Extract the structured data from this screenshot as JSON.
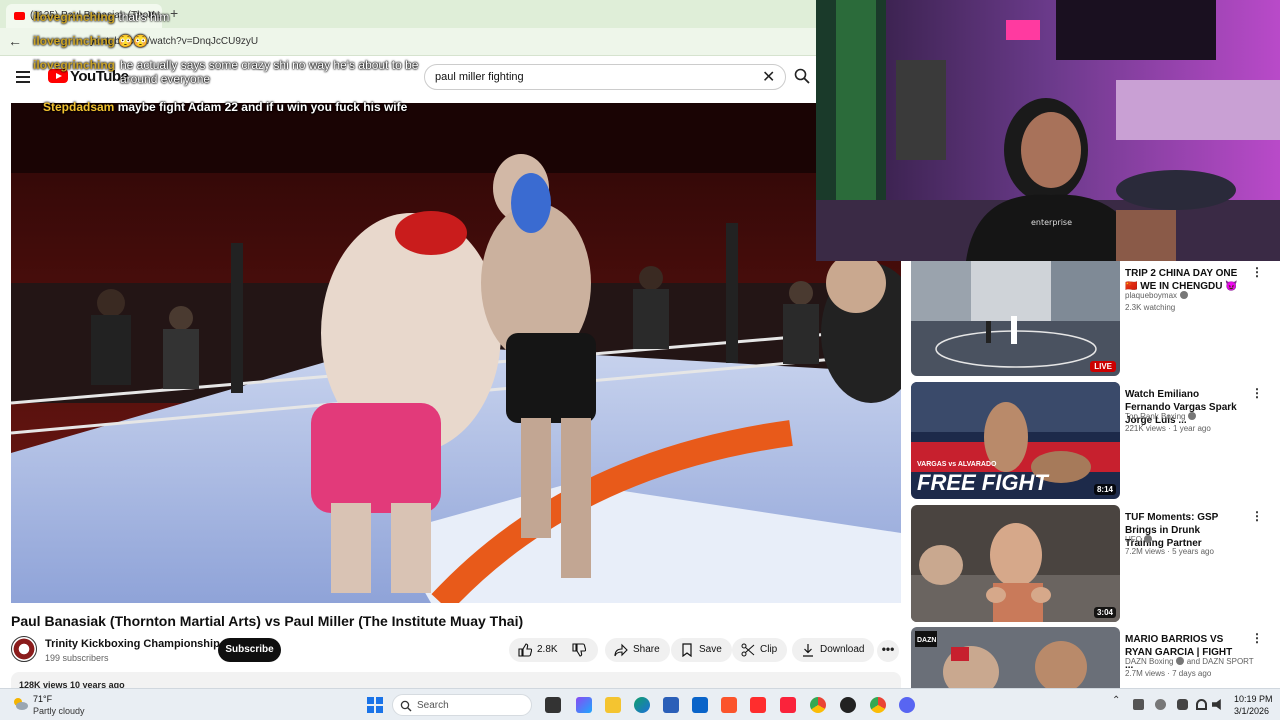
{
  "browser": {
    "tab_title": "(1125) Paul Banasiak (Thornt",
    "tab_close": "✕",
    "new_tab": "+",
    "url": "youtube.com/watch?v=DnqJcCU9zyU",
    "back": "←"
  },
  "youtube": {
    "logo_text": "YouTube",
    "search_query": "paul miller fighting",
    "search_clear": "✕"
  },
  "chat": [
    {
      "user": "ilovegrinching",
      "message": "that's him"
    },
    {
      "user": "ilovegrinching",
      "message": "😳😳"
    },
    {
      "user": "ilovegrinching",
      "message": "he actually says some crazy shi no way he's about to be around everyone"
    },
    {
      "user": "Stepdadsam",
      "message": "maybe fight Adam 22 and if u win you fuck his wife"
    }
  ],
  "video": {
    "title": "Paul Banasiak (Thornton Martial Arts) vs Paul Miller (The Institute Muay Thai)",
    "channel": "Trinity Kickboxing Championship",
    "subscribers": "199 subscribers",
    "subscribe_label": "Subscribe",
    "likes": "2.8K",
    "share_label": "Share",
    "save_label": "Save",
    "clip_label": "Clip",
    "download_label": "Download",
    "more_label": "•••",
    "views_date": "128K views  10 years ago"
  },
  "recommendations": [
    {
      "title": "TRIP 2 CHINA DAY ONE 🇨🇳 WE IN CHENGDU 😈",
      "channel": "plaqueboymax",
      "meta": "2.3K watching",
      "badge": "LIVE",
      "verified": true
    },
    {
      "title": "Watch Emiliano Fernando Vargas Spark Jorge Luis ...",
      "channel": "Top Rank Boxing",
      "meta": "221K views · 1 year ago",
      "badge": "8:14",
      "thumb_text": "FREE FIGHT",
      "thumb_sub": "VARGAS vs ALVARADO",
      "verified": true
    },
    {
      "title": "TUF Moments: GSP Brings in Drunk Training Partner",
      "channel": "UFC",
      "meta": "7.2M views · 5 years ago",
      "badge": "3:04",
      "verified": true
    },
    {
      "title": "MARIO BARRIOS VS RYAN GARCIA | FIGHT ...",
      "channel": "DAZN Boxing",
      "channel_extra": "and DAZN SPORT",
      "meta": "2.7M views · 7 days ago",
      "badge": "",
      "thumb_text": "DAZN",
      "verified": true
    }
  ],
  "taskbar": {
    "temperature": "71°F",
    "weather": "Partly cloudy",
    "search_placeholder": "Search",
    "time": "10:19 PM",
    "date": "3/1/2026"
  },
  "cam": {
    "shirt_text": "enterprise"
  },
  "colors": {
    "youtube_red": "#ff0000",
    "subscribe_bg": "#0f0f0f",
    "chat_user": "#c9a227",
    "live_red": "#cc0000"
  }
}
